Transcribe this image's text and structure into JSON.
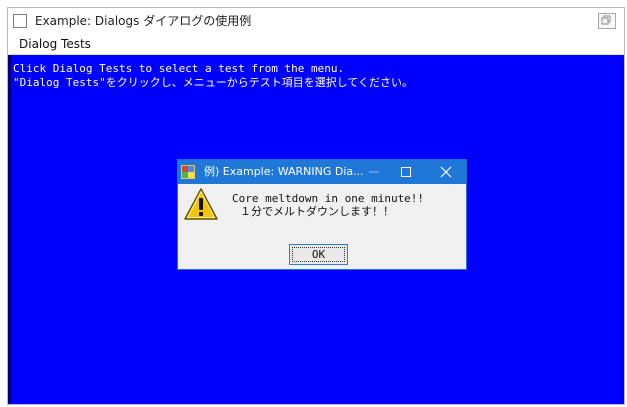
{
  "window": {
    "title": "Example: Dialogs  ダイアログの使用例",
    "icon": "window-icon",
    "controls": {
      "restore": "restore-icon"
    }
  },
  "menubar": {
    "items": [
      {
        "label": "Dialog Tests"
      }
    ]
  },
  "console": {
    "background": "#0000ff",
    "text_color": "#ffffff",
    "lines": [
      "Click Dialog Tests to select a test from the menu.",
      "\"Dialog Tests\"をクリックし、メニューからテスト項目を選択してください。"
    ]
  },
  "dialog": {
    "title": "例) Example: WARNING Dia...",
    "icon": "app-icon",
    "titlebar_color": "#1f78d8",
    "controls": {
      "minimize": "minimize-icon",
      "maximize": "maximize-icon",
      "close": "close-icon"
    },
    "message_icon": "warning-icon",
    "message_lines": [
      "Core meltdown in one minute!!",
      "１分でメルトダウンします！！"
    ],
    "ok_label": "OK"
  }
}
